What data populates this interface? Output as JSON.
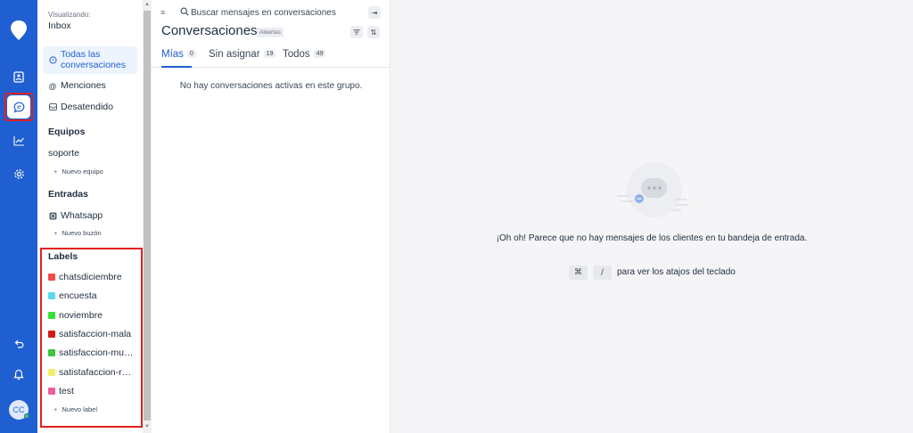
{
  "rail": {
    "items": [
      "logo-icon",
      "contacts-icon",
      "conversations-icon",
      "reports-icon",
      "settings-icon",
      "back-icon",
      "notifications-icon"
    ],
    "avatar_initials": "CC",
    "accent": "#1f5fd1"
  },
  "sidebar": {
    "viewing_label": "Visualizando:",
    "viewing_value": "Inbox",
    "nav": [
      {
        "label": "Todas las conversaciones",
        "icon": "chat-icon",
        "active": true
      },
      {
        "label": "Menciones",
        "icon": "at-icon"
      },
      {
        "label": "Desatendido",
        "icon": "inbox-icon"
      }
    ],
    "teams": {
      "heading": "Equipos",
      "items": [
        "soporte"
      ],
      "add": "Nuevo equipo"
    },
    "inboxes": {
      "heading": "Entradas",
      "items": [
        "Whatsapp"
      ],
      "add": "Nuevo buzón"
    },
    "labels": {
      "heading": "Labels",
      "items": [
        {
          "name": "chatsdiciembre",
          "color": "#f04a4a"
        },
        {
          "name": "encuesta",
          "color": "#5fd7f0"
        },
        {
          "name": "noviembre",
          "color": "#34e034"
        },
        {
          "name": "satisfaccion-mala",
          "color": "#d51a1a"
        },
        {
          "name": "satisfaccion-mu…",
          "color": "#3fc43f"
        },
        {
          "name": "satistafaccion-r…",
          "color": "#f4ee6a"
        },
        {
          "name": "test",
          "color": "#ec5da0"
        }
      ],
      "add": "Nuevo label"
    }
  },
  "list": {
    "search_placeholder": "Buscar mensajes en conversaciones",
    "title": "Conversaciones",
    "status": "Abiertas",
    "tabs": [
      {
        "label": "Mías",
        "count": "0"
      },
      {
        "label": "Sin asignar",
        "count": "19"
      },
      {
        "label": "Todos",
        "count": "49"
      }
    ],
    "empty": "No hay conversaciones activas en este grupo."
  },
  "main": {
    "empty_message": "¡Oh oh! Parece que no hay mensajes de los clientes en tu bandeja de entrada.",
    "kbd_1": "⌘",
    "kbd_2": "/",
    "kbd_hint": "para ver los atajos del teclado"
  }
}
